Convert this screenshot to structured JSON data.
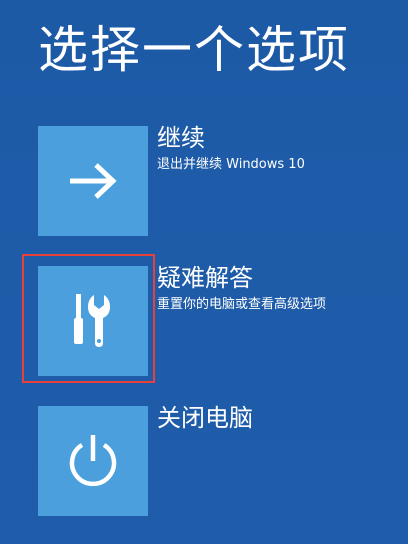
{
  "page": {
    "title": "选择一个选项"
  },
  "options": [
    {
      "label": "继续",
      "description": "退出并继续 Windows 10",
      "icon": "arrow-right-icon"
    },
    {
      "label": "疑难解答",
      "description": "重置你的电脑或查看高级选项",
      "icon": "tools-icon"
    },
    {
      "label": "关闭电脑",
      "description": "",
      "icon": "power-icon"
    }
  ],
  "colors": {
    "background": "#1e5aa8",
    "tile": "#4a9fdc",
    "text": "#ffffff",
    "highlight": "#e8403a"
  }
}
